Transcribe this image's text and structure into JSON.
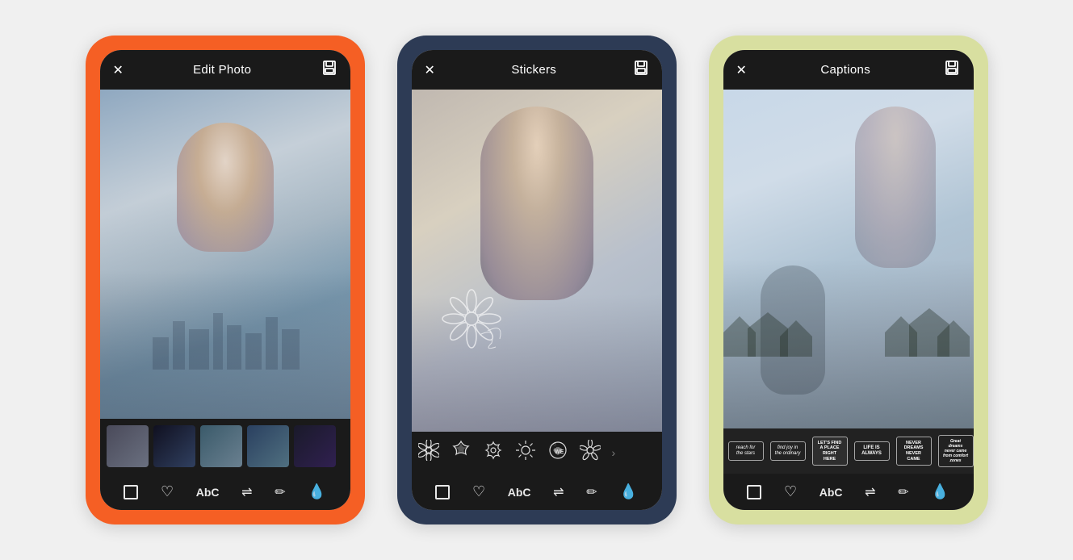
{
  "screens": [
    {
      "id": "edit-photo",
      "wrapperColor": "orange",
      "header": {
        "closeLabel": "✕",
        "title": "Edit Photo",
        "saveLabel": "⊞"
      },
      "photoType": "photo-1",
      "bottomPanelType": "thumbnails",
      "thumbnails": [
        "thumb-1",
        "thumb-2",
        "thumb-3",
        "thumb-4",
        "thumb-5"
      ],
      "toolbar": {
        "icons": [
          "square",
          "heart",
          "text",
          "sliders",
          "pencil",
          "drop"
        ]
      }
    },
    {
      "id": "stickers",
      "wrapperColor": "navy",
      "header": {
        "closeLabel": "✕",
        "title": "Stickers",
        "saveLabel": "⊞"
      },
      "photoType": "photo-2",
      "bottomPanelType": "stickers",
      "stickerItems": [
        "❋",
        "✿",
        "✾",
        "❊",
        "✲",
        "❃",
        "✺",
        "❈"
      ],
      "toolbar": {
        "icons": [
          "square",
          "heart",
          "text",
          "sliders",
          "pencil",
          "drop"
        ]
      }
    },
    {
      "id": "captions",
      "wrapperColor": "lime",
      "header": {
        "closeLabel": "✕",
        "title": "Captions",
        "saveLabel": "⊞"
      },
      "photoType": "photo-3",
      "bottomPanelType": "captions",
      "captionItems": [
        "reach for the stars",
        "find joy in the ordinary",
        "LET'S FIND A PLACE RIGHT HERE",
        "LIFE IS ALWAYS",
        "NEVER dreams never came",
        "Great dreams never came from comfort zones"
      ],
      "toolbar": {
        "icons": [
          "square",
          "heart",
          "text",
          "sliders",
          "pencil",
          "drop"
        ]
      }
    }
  ],
  "toolbar": {
    "squareTitle": "□",
    "heartTitle": "♡",
    "textTitle": "AbC",
    "slidersTitle": "⇄",
    "pencilTitle": "✏",
    "dropTitle": "◉"
  }
}
